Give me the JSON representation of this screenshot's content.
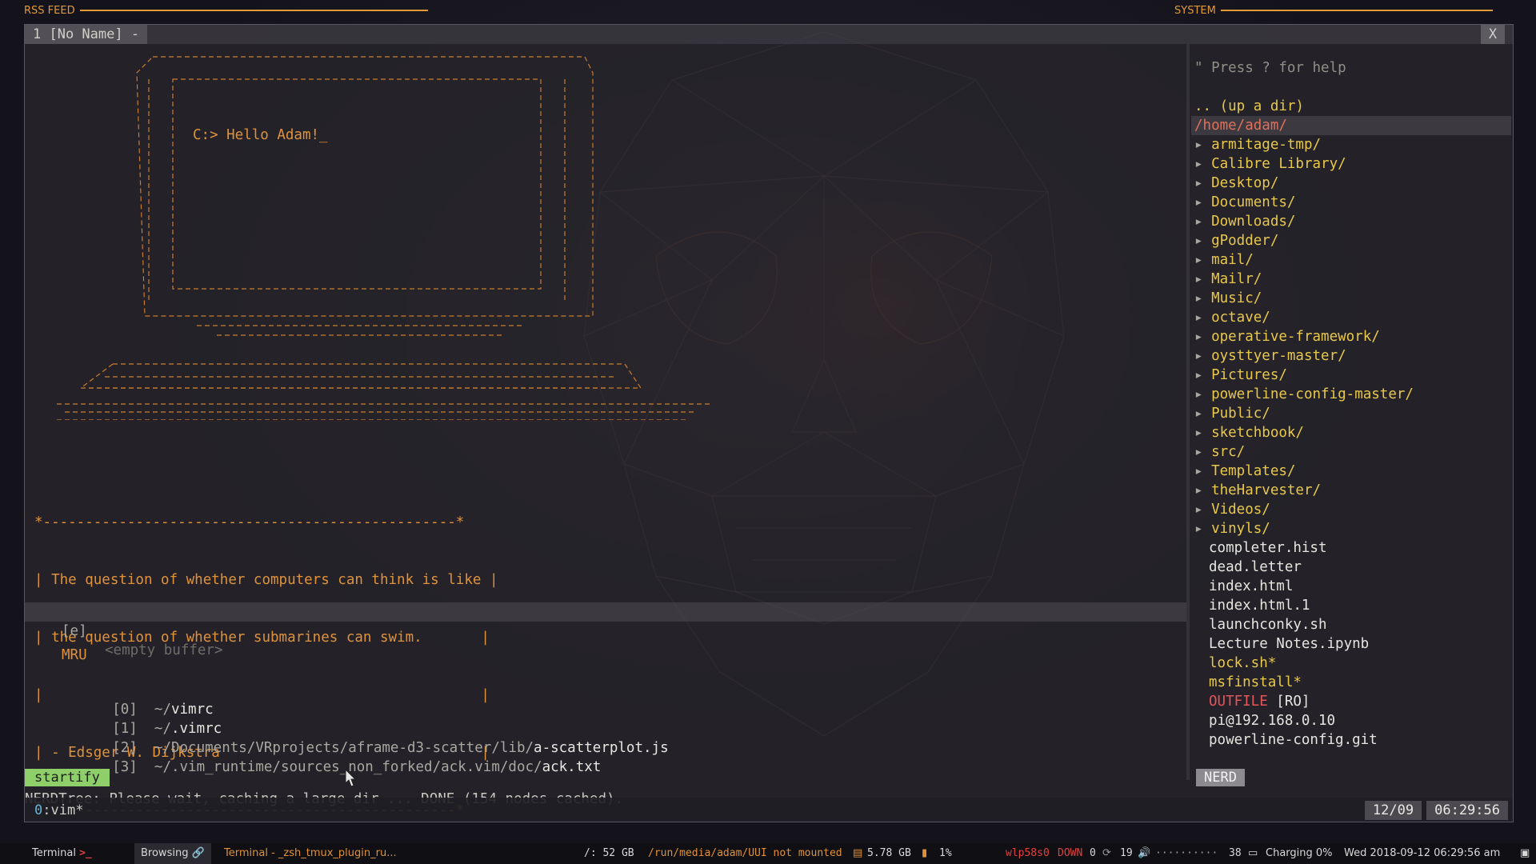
{
  "top_labels": {
    "left": "RSS FEED",
    "right": "SYSTEM"
  },
  "window": {
    "tab_label": "1 [No Name] -",
    "close_label": "X"
  },
  "startify": {
    "header_line": "C:> Hello Adam!_",
    "quote": [
      "*-------------------------------------------------*",
      "| The question of whether computers can think is like |",
      "| the question of whether submarines can swim.       |",
      "|                                                    |",
      "| - Edsger W. Dijkstra                               |",
      "*-------------------------------------------------*"
    ],
    "empty_key": "[e]",
    "empty_label": "<empty buffer>",
    "mru_title": "MRU",
    "mru": [
      {
        "key": "[0]",
        "path": "~/",
        "file": "vimrc"
      },
      {
        "key": "[1]",
        "path": "~/",
        "file": ".vimrc"
      },
      {
        "key": "[2]",
        "path": "~/Documents/VRprojects/aframe-d3-scatter/lib/",
        "file": "a-scatterplot.js"
      },
      {
        "key": "[3]",
        "path": "~/.vim_runtime/sources_non_forked/ack.vim/doc/",
        "file": "ack.txt"
      }
    ]
  },
  "nerdtree": {
    "help": "\" Press ? for help",
    "up": ".. (up a dir)",
    "root": "/home/adam/",
    "dirs": [
      "armitage-tmp/",
      "Calibre Library/",
      "Desktop/",
      "Documents/",
      "Downloads/",
      "gPodder/",
      "mail/",
      "Mailr/",
      "Music/",
      "octave/",
      "operative-framework/",
      "oysttyer-master/",
      "Pictures/",
      "powerline-config-master/",
      "Public/",
      "sketchbook/",
      "src/",
      "Templates/",
      "theHarvester/",
      "Videos/",
      "vinyls/"
    ],
    "files": [
      {
        "name": "completer.hist"
      },
      {
        "name": "dead.letter"
      },
      {
        "name": "index.html"
      },
      {
        "name": "index.html.1"
      },
      {
        "name": "launchconky.sh"
      },
      {
        "name": "Lecture Notes.ipynb"
      },
      {
        "name": "lock.sh*",
        "style": "gold"
      },
      {
        "name": "msfinstall*",
        "style": "gold"
      },
      {
        "name": "OUTFILE",
        "style": "red",
        "suffix": " [RO]"
      },
      {
        "name": "pi@192.168.0.10"
      },
      {
        "name": "powerline-config.git"
      }
    ],
    "label": "NERD"
  },
  "statusline": {
    "mode": "startify"
  },
  "message": "NERDTree: Please wait, caching a large dir ... DONE (154 nodes cached).",
  "tmux": {
    "window_index": "0",
    "window_name": ":vim*",
    "date": "12/09",
    "time": "06:29:56"
  },
  "taskbar": {
    "terminal_label": "Terminal",
    "browsing_label": "Browsing",
    "active_window": "Terminal - _zsh_tmux_plugin_ru...",
    "disk_root": "/: 52 GB",
    "mount": "/run/media/adam/UUI not mounted",
    "storage": "5.78 GB",
    "cpu": "1%",
    "net_iface": "wlp58s0",
    "net_state": "DOWN",
    "net_count": "0",
    "updates": "19",
    "volume_dots": "··········",
    "volume": "38",
    "battery": "Charging 0%",
    "datetime": "Wed 2018-09-12 06:29:56 am"
  },
  "colors": {
    "accent": "#e0923a",
    "statusline_green": "#8fcf6a",
    "dir_gold": "#e8c84a",
    "nerd_red": "#e5555a"
  }
}
